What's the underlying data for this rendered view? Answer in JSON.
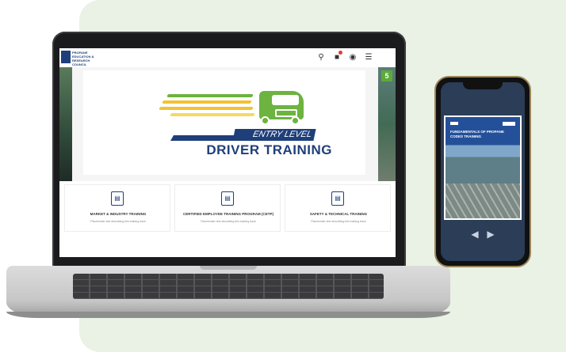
{
  "header": {
    "logo_text": "PROPANE EDUCATION & RESEARCH COUNCIL",
    "search_icon": "search-icon",
    "cart_icon": "cart-icon",
    "user_icon": "user-icon",
    "menu_icon": "menu-icon"
  },
  "hero": {
    "subtitle": "ENTRY LEVEL",
    "title": "DRIVER TRAINING",
    "slide_badge": "5",
    "colors": {
      "green": "#6cb33f",
      "navy": "#1f3f7a",
      "yellow": "#f2c230"
    }
  },
  "cards": [
    {
      "title": "MARKET & INDUSTRY TRAINING",
      "desc": "Placeholder text describing this training track"
    },
    {
      "title": "CERTIFIED EMPLOYEE TRAINING PROGRAM (CETP)",
      "desc": "Placeholder text describing this training track"
    },
    {
      "title": "SAFETY & TECHNICAL TRAINING",
      "desc": "Placeholder text describing this training track"
    }
  ],
  "phone": {
    "card_title": "FUNDAMENTALS OF PROPANE CODES TRAINING",
    "prev_icon": "chevron-left-icon",
    "next_icon": "chevron-right-icon"
  }
}
